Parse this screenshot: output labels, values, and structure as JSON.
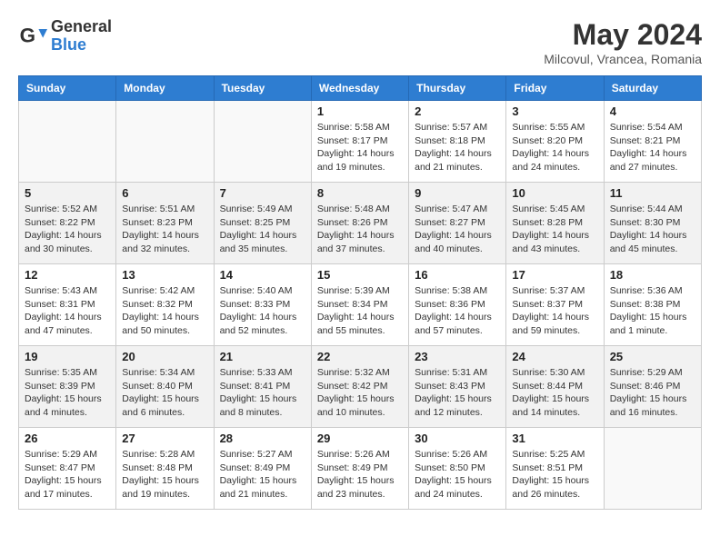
{
  "header": {
    "logo_general": "General",
    "logo_blue": "Blue",
    "month_year": "May 2024",
    "location": "Milcovul, Vrancea, Romania"
  },
  "days_of_week": [
    "Sunday",
    "Monday",
    "Tuesday",
    "Wednesday",
    "Thursday",
    "Friday",
    "Saturday"
  ],
  "weeks": [
    [
      {
        "day": "",
        "sunrise": "",
        "sunset": "",
        "daylight": "",
        "empty": true
      },
      {
        "day": "",
        "sunrise": "",
        "sunset": "",
        "daylight": "",
        "empty": true
      },
      {
        "day": "",
        "sunrise": "",
        "sunset": "",
        "daylight": "",
        "empty": true
      },
      {
        "day": "1",
        "sunrise": "Sunrise: 5:58 AM",
        "sunset": "Sunset: 8:17 PM",
        "daylight": "Daylight: 14 hours and 19 minutes.",
        "empty": false
      },
      {
        "day": "2",
        "sunrise": "Sunrise: 5:57 AM",
        "sunset": "Sunset: 8:18 PM",
        "daylight": "Daylight: 14 hours and 21 minutes.",
        "empty": false
      },
      {
        "day": "3",
        "sunrise": "Sunrise: 5:55 AM",
        "sunset": "Sunset: 8:20 PM",
        "daylight": "Daylight: 14 hours and 24 minutes.",
        "empty": false
      },
      {
        "day": "4",
        "sunrise": "Sunrise: 5:54 AM",
        "sunset": "Sunset: 8:21 PM",
        "daylight": "Daylight: 14 hours and 27 minutes.",
        "empty": false
      }
    ],
    [
      {
        "day": "5",
        "sunrise": "Sunrise: 5:52 AM",
        "sunset": "Sunset: 8:22 PM",
        "daylight": "Daylight: 14 hours and 30 minutes.",
        "empty": false
      },
      {
        "day": "6",
        "sunrise": "Sunrise: 5:51 AM",
        "sunset": "Sunset: 8:23 PM",
        "daylight": "Daylight: 14 hours and 32 minutes.",
        "empty": false
      },
      {
        "day": "7",
        "sunrise": "Sunrise: 5:49 AM",
        "sunset": "Sunset: 8:25 PM",
        "daylight": "Daylight: 14 hours and 35 minutes.",
        "empty": false
      },
      {
        "day": "8",
        "sunrise": "Sunrise: 5:48 AM",
        "sunset": "Sunset: 8:26 PM",
        "daylight": "Daylight: 14 hours and 37 minutes.",
        "empty": false
      },
      {
        "day": "9",
        "sunrise": "Sunrise: 5:47 AM",
        "sunset": "Sunset: 8:27 PM",
        "daylight": "Daylight: 14 hours and 40 minutes.",
        "empty": false
      },
      {
        "day": "10",
        "sunrise": "Sunrise: 5:45 AM",
        "sunset": "Sunset: 8:28 PM",
        "daylight": "Daylight: 14 hours and 43 minutes.",
        "empty": false
      },
      {
        "day": "11",
        "sunrise": "Sunrise: 5:44 AM",
        "sunset": "Sunset: 8:30 PM",
        "daylight": "Daylight: 14 hours and 45 minutes.",
        "empty": false
      }
    ],
    [
      {
        "day": "12",
        "sunrise": "Sunrise: 5:43 AM",
        "sunset": "Sunset: 8:31 PM",
        "daylight": "Daylight: 14 hours and 47 minutes.",
        "empty": false
      },
      {
        "day": "13",
        "sunrise": "Sunrise: 5:42 AM",
        "sunset": "Sunset: 8:32 PM",
        "daylight": "Daylight: 14 hours and 50 minutes.",
        "empty": false
      },
      {
        "day": "14",
        "sunrise": "Sunrise: 5:40 AM",
        "sunset": "Sunset: 8:33 PM",
        "daylight": "Daylight: 14 hours and 52 minutes.",
        "empty": false
      },
      {
        "day": "15",
        "sunrise": "Sunrise: 5:39 AM",
        "sunset": "Sunset: 8:34 PM",
        "daylight": "Daylight: 14 hours and 55 minutes.",
        "empty": false
      },
      {
        "day": "16",
        "sunrise": "Sunrise: 5:38 AM",
        "sunset": "Sunset: 8:36 PM",
        "daylight": "Daylight: 14 hours and 57 minutes.",
        "empty": false
      },
      {
        "day": "17",
        "sunrise": "Sunrise: 5:37 AM",
        "sunset": "Sunset: 8:37 PM",
        "daylight": "Daylight: 14 hours and 59 minutes.",
        "empty": false
      },
      {
        "day": "18",
        "sunrise": "Sunrise: 5:36 AM",
        "sunset": "Sunset: 8:38 PM",
        "daylight": "Daylight: 15 hours and 1 minute.",
        "empty": false
      }
    ],
    [
      {
        "day": "19",
        "sunrise": "Sunrise: 5:35 AM",
        "sunset": "Sunset: 8:39 PM",
        "daylight": "Daylight: 15 hours and 4 minutes.",
        "empty": false
      },
      {
        "day": "20",
        "sunrise": "Sunrise: 5:34 AM",
        "sunset": "Sunset: 8:40 PM",
        "daylight": "Daylight: 15 hours and 6 minutes.",
        "empty": false
      },
      {
        "day": "21",
        "sunrise": "Sunrise: 5:33 AM",
        "sunset": "Sunset: 8:41 PM",
        "daylight": "Daylight: 15 hours and 8 minutes.",
        "empty": false
      },
      {
        "day": "22",
        "sunrise": "Sunrise: 5:32 AM",
        "sunset": "Sunset: 8:42 PM",
        "daylight": "Daylight: 15 hours and 10 minutes.",
        "empty": false
      },
      {
        "day": "23",
        "sunrise": "Sunrise: 5:31 AM",
        "sunset": "Sunset: 8:43 PM",
        "daylight": "Daylight: 15 hours and 12 minutes.",
        "empty": false
      },
      {
        "day": "24",
        "sunrise": "Sunrise: 5:30 AM",
        "sunset": "Sunset: 8:44 PM",
        "daylight": "Daylight: 15 hours and 14 minutes.",
        "empty": false
      },
      {
        "day": "25",
        "sunrise": "Sunrise: 5:29 AM",
        "sunset": "Sunset: 8:46 PM",
        "daylight": "Daylight: 15 hours and 16 minutes.",
        "empty": false
      }
    ],
    [
      {
        "day": "26",
        "sunrise": "Sunrise: 5:29 AM",
        "sunset": "Sunset: 8:47 PM",
        "daylight": "Daylight: 15 hours and 17 minutes.",
        "empty": false
      },
      {
        "day": "27",
        "sunrise": "Sunrise: 5:28 AM",
        "sunset": "Sunset: 8:48 PM",
        "daylight": "Daylight: 15 hours and 19 minutes.",
        "empty": false
      },
      {
        "day": "28",
        "sunrise": "Sunrise: 5:27 AM",
        "sunset": "Sunset: 8:49 PM",
        "daylight": "Daylight: 15 hours and 21 minutes.",
        "empty": false
      },
      {
        "day": "29",
        "sunrise": "Sunrise: 5:26 AM",
        "sunset": "Sunset: 8:49 PM",
        "daylight": "Daylight: 15 hours and 23 minutes.",
        "empty": false
      },
      {
        "day": "30",
        "sunrise": "Sunrise: 5:26 AM",
        "sunset": "Sunset: 8:50 PM",
        "daylight": "Daylight: 15 hours and 24 minutes.",
        "empty": false
      },
      {
        "day": "31",
        "sunrise": "Sunrise: 5:25 AM",
        "sunset": "Sunset: 8:51 PM",
        "daylight": "Daylight: 15 hours and 26 minutes.",
        "empty": false
      },
      {
        "day": "",
        "sunrise": "",
        "sunset": "",
        "daylight": "",
        "empty": true
      }
    ]
  ]
}
